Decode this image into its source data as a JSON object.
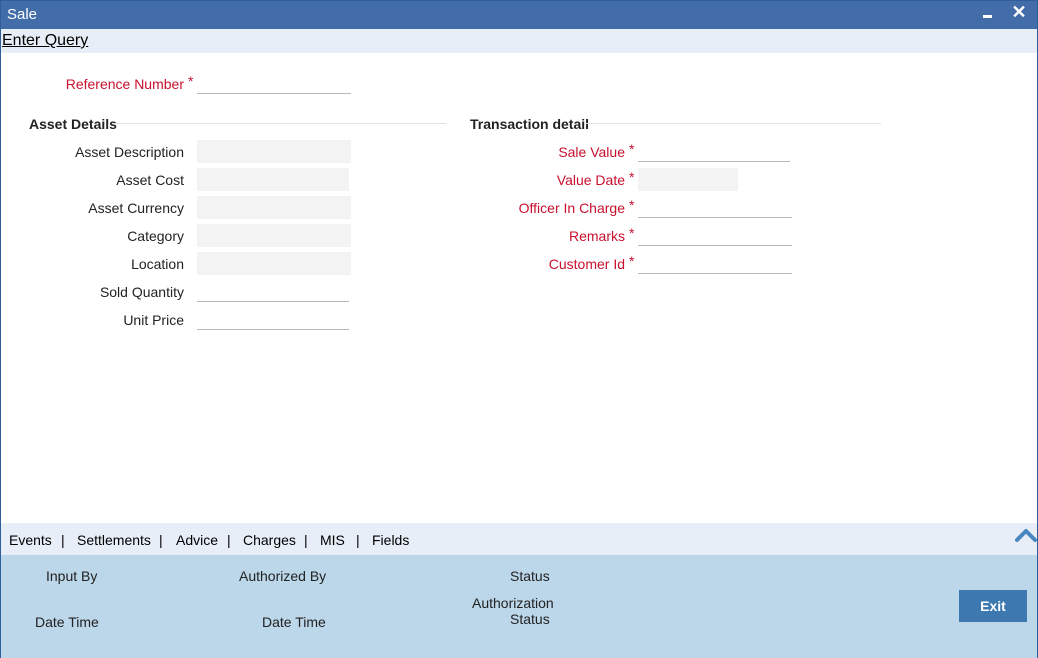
{
  "window": {
    "title": "Sale"
  },
  "toolbar": {
    "enter_query": "Enter Query"
  },
  "reference": {
    "label": "Reference Number",
    "value": ""
  },
  "asset_details": {
    "heading": "Asset Details",
    "fields": [
      {
        "label": "Asset Description",
        "value": ""
      },
      {
        "label": "Asset Cost",
        "value": ""
      },
      {
        "label": "Asset Currency",
        "value": ""
      },
      {
        "label": "Category",
        "value": ""
      },
      {
        "label": "Location",
        "value": ""
      },
      {
        "label": "Sold Quantity",
        "value": ""
      },
      {
        "label": "Unit Price",
        "value": ""
      }
    ]
  },
  "transaction_detail": {
    "heading": "Transaction detail",
    "fields": [
      {
        "label": "Sale Value",
        "value": ""
      },
      {
        "label": "Value Date",
        "value": ""
      },
      {
        "label": "Officer In Charge",
        "value": ""
      },
      {
        "label": "Remarks",
        "value": ""
      },
      {
        "label": "Customer Id",
        "value": ""
      }
    ]
  },
  "required_mark": "*",
  "tabs": [
    "Events",
    "Settlements",
    "Advice",
    "Charges",
    "MIS",
    "Fields"
  ],
  "tab_separator": "|",
  "footer": {
    "input_by": "Input By",
    "date_time_1": "Date Time",
    "authorized_by": "Authorized By",
    "date_time_2": "Date Time",
    "status": "Status",
    "authorization_status_line1": "Authorization",
    "authorization_status_line2": "Status",
    "exit_label": "Exit"
  },
  "icons": {
    "minimize": "minimize-icon",
    "close": "close-icon",
    "collapse": "chevron-up-icon"
  },
  "colors": {
    "title_bar": "#426da9",
    "footer": "#bcd6ea",
    "required": "#c8102e",
    "exit_button": "#3d78b1"
  }
}
